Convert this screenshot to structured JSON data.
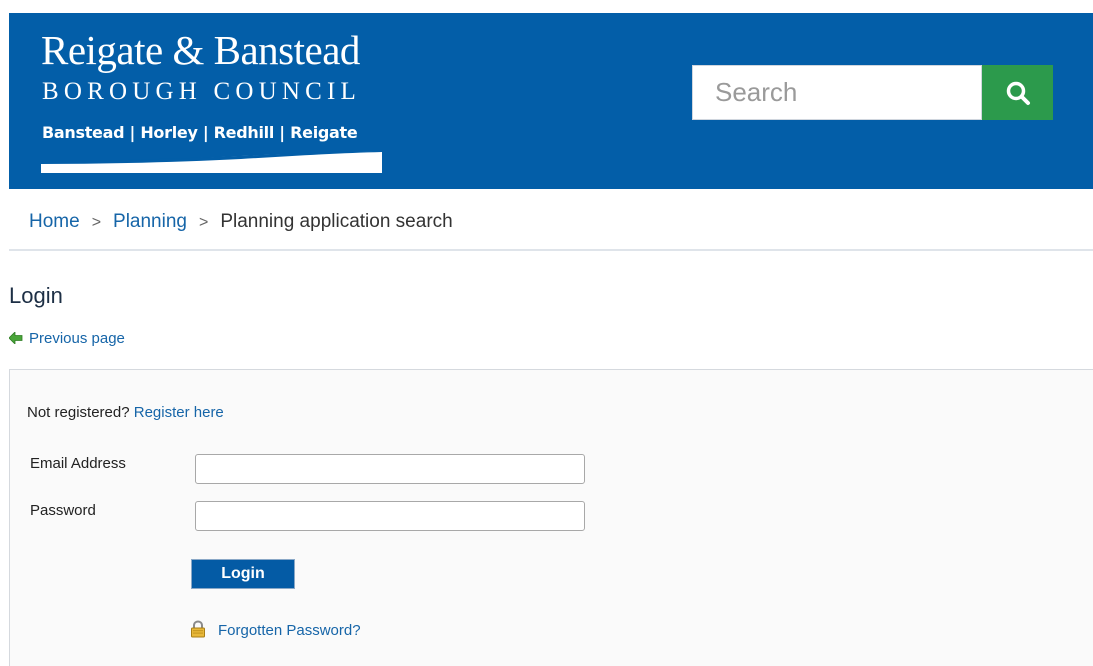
{
  "header": {
    "logo": {
      "title": "Reigate & Banstead",
      "subtitle": "BOROUGH COUNCIL",
      "towns": "Banstead | Horley | Redhill | Reigate"
    },
    "search": {
      "placeholder": "Search",
      "button_icon": "search-icon"
    }
  },
  "breadcrumb": {
    "items": [
      "Home",
      "Planning",
      "Planning application search"
    ],
    "separator": ">"
  },
  "page": {
    "title": "Login",
    "previous_link": "Previous page",
    "previous_icon": "left-arrow-icon"
  },
  "form": {
    "not_registered_text": "Not registered?",
    "register_link": "Register here",
    "email_label": "Email Address",
    "email_value": "",
    "password_label": "Password",
    "password_value": "",
    "login_button": "Login",
    "forgot_link": "Forgotten Password?",
    "forgot_icon": "lock-icon"
  },
  "colors": {
    "header_bg": "#035ea8",
    "search_button_bg": "#2c9a4c",
    "link": "#1665a8",
    "login_button_bg": "#045ba5"
  }
}
